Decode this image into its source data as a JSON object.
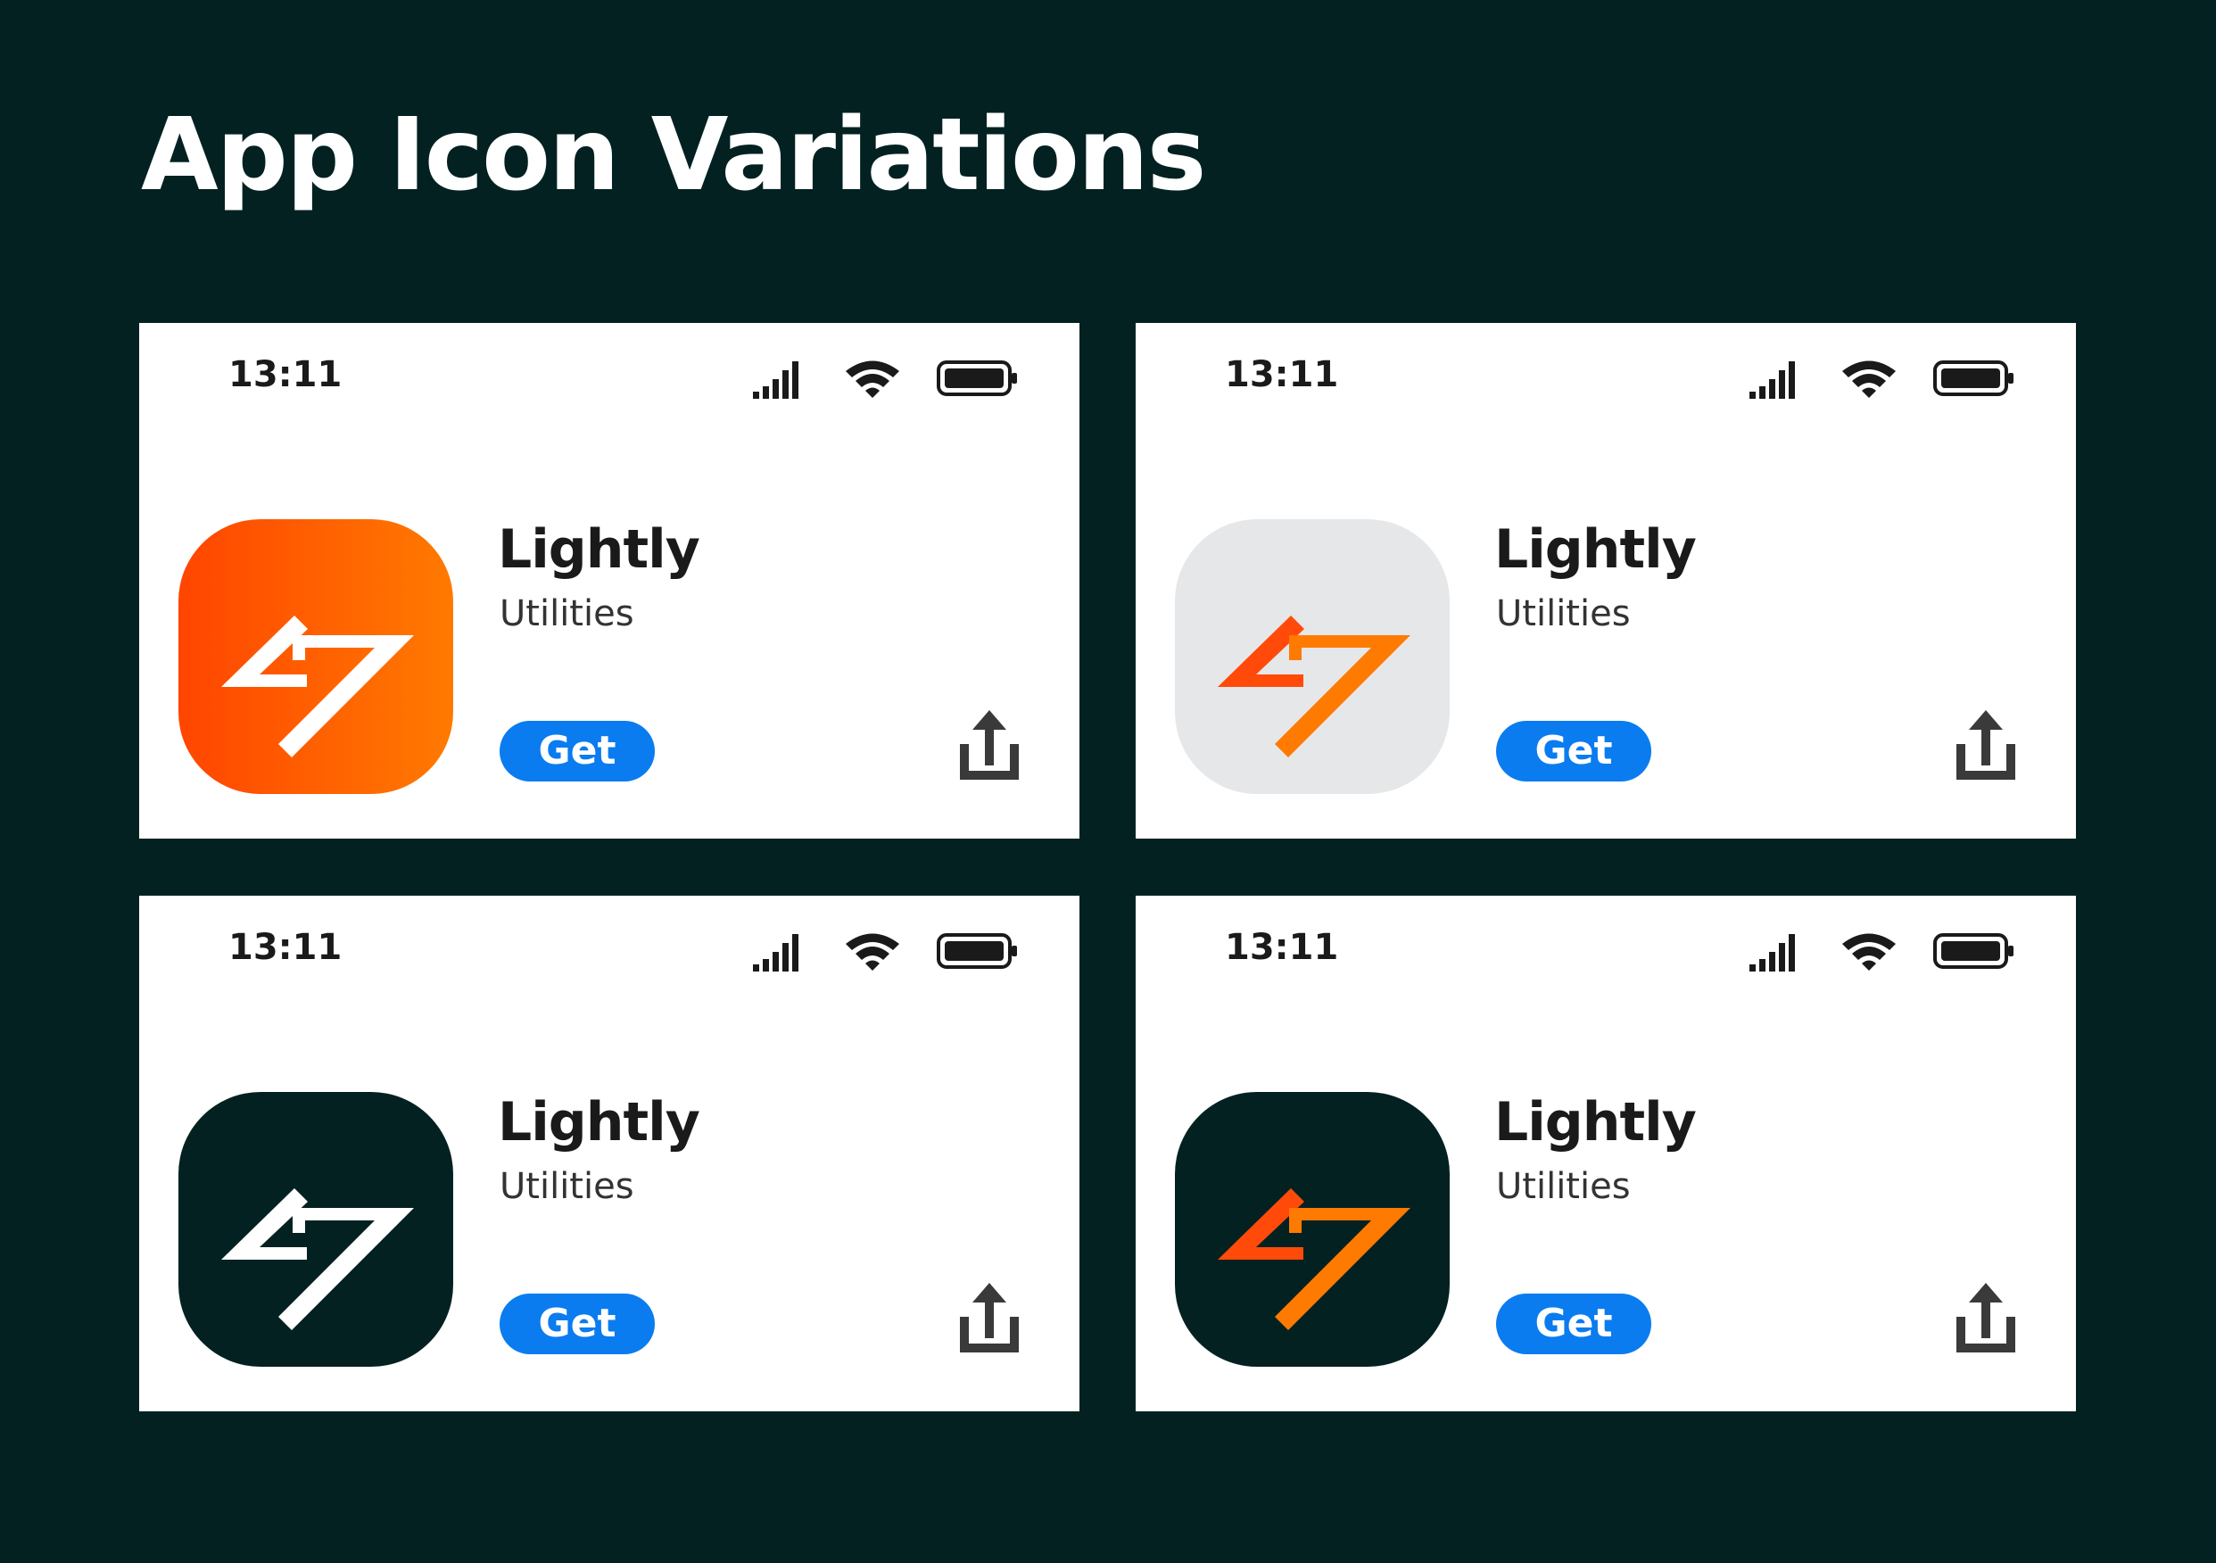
{
  "title": "App Icon Variations",
  "colors": {
    "background": "#042121",
    "card": "#ffffff",
    "get_button": "#0a7cf0",
    "orange_start": "#ff4500",
    "orange_end": "#ff7a00",
    "light_icon_bg": "#e6e7e9",
    "dark_icon_bg": "#042121"
  },
  "cards": [
    {
      "status_time": "13:11",
      "app_name": "Lightly",
      "category": "Utilities",
      "get_label": "Get",
      "icon_variant": "orange-background-white-bolt"
    },
    {
      "status_time": "13:11",
      "app_name": "Lightly",
      "category": "Utilities",
      "get_label": "Get",
      "icon_variant": "light-gray-background-orange-bolt"
    },
    {
      "status_time": "13:11",
      "app_name": "Lightly",
      "category": "Utilities",
      "get_label": "Get",
      "icon_variant": "dark-background-white-bolt"
    },
    {
      "status_time": "13:11",
      "app_name": "Lightly",
      "category": "Utilities",
      "get_label": "Get",
      "icon_variant": "dark-background-orange-bolt"
    }
  ],
  "icons": {
    "signal": "signal-icon",
    "wifi": "wifi-icon",
    "battery": "battery-icon",
    "share": "share-icon",
    "app": "lightning-bolt-icon"
  }
}
